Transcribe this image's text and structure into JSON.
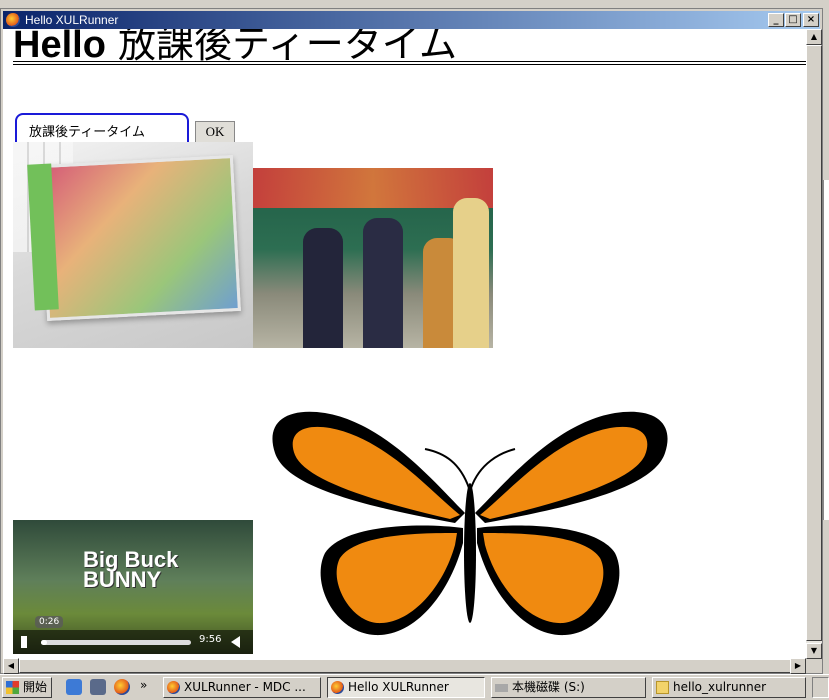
{
  "window": {
    "title": "Hello XULRunner",
    "buttons": {
      "minimize": "_",
      "maximize": "□",
      "close": "×"
    }
  },
  "page": {
    "heading_bold": "Hello",
    "heading_rest": " 放課後ティータイム",
    "input": {
      "value": "放課後ティータイム"
    },
    "ok_label": "OK",
    "video": {
      "title_line1": "Big Buck",
      "title_line2": "BUNNY",
      "current_time": "0:26",
      "duration": "9:56",
      "progress": 0.04
    }
  },
  "taskbar": {
    "start_label": "開始",
    "more": "»",
    "tasks": [
      {
        "label": "XULRunner - MDC ...",
        "active": false
      },
      {
        "label": "Hello XULRunner",
        "active": true
      },
      {
        "label": "本機磁碟 (S:)",
        "active": false
      },
      {
        "label": "hello_xulrunner",
        "active": false
      }
    ]
  },
  "colors": {
    "titlebar": "#0a246a",
    "input_border": "#1a1ad8",
    "butterfly_orange": "#f08a10"
  }
}
